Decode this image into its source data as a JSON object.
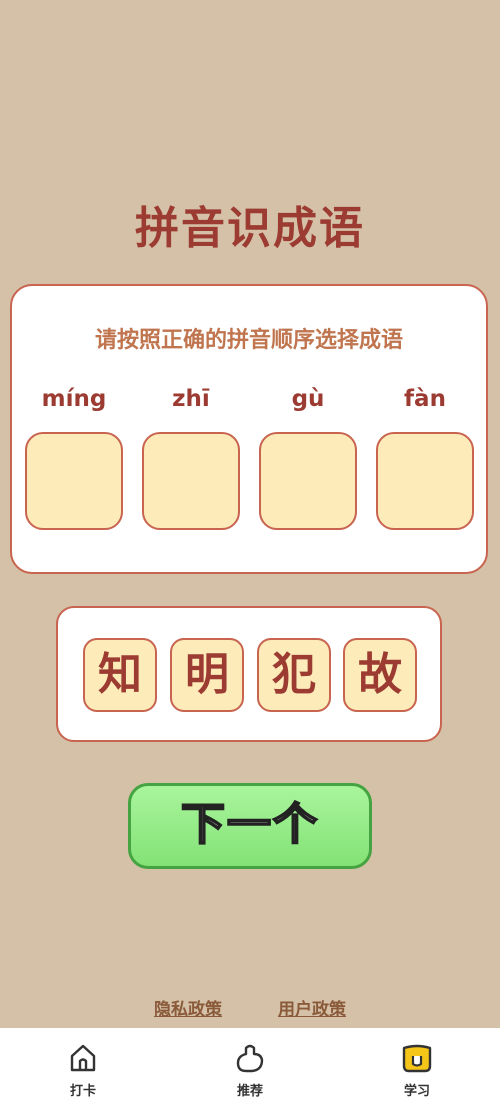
{
  "title": "拼音识成语",
  "instruction": "请按照正确的拼音顺序选择成语",
  "pinyin": [
    "míng",
    "zhī",
    "gù",
    "fàn"
  ],
  "choices": [
    "知",
    "明",
    "犯",
    "故"
  ],
  "next_label": "下一个",
  "links": {
    "privacy": "隐私政策",
    "user": "用户政策"
  },
  "tabs": [
    {
      "label": "打卡",
      "icon": "home-icon"
    },
    {
      "label": "推荐",
      "icon": "thumb-icon"
    },
    {
      "label": "学习",
      "icon": "study-icon"
    }
  ],
  "colors": {
    "background": "#d4c1a7",
    "accent": "#9c3b32",
    "slot_fill": "#fdebb9",
    "button_green": "#83e276",
    "active_tab": "#f5c518"
  }
}
